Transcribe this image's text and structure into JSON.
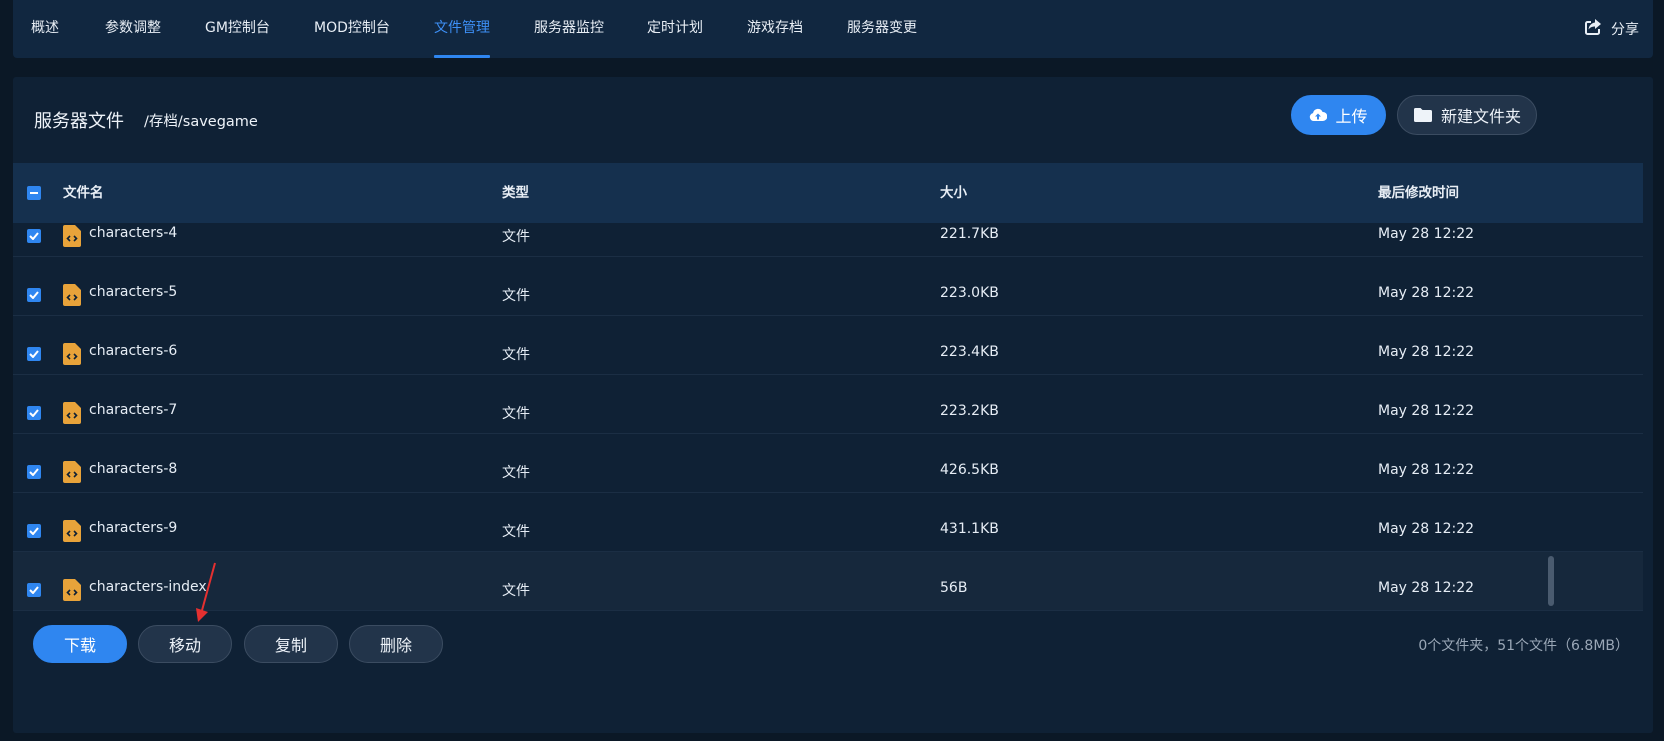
{
  "nav": {
    "tabs": [
      {
        "label": "概述"
      },
      {
        "label": "参数调整"
      },
      {
        "label": "GM控制台"
      },
      {
        "label": "MOD控制台"
      },
      {
        "label": "文件管理",
        "active": true
      },
      {
        "label": "服务器监控"
      },
      {
        "label": "定时计划"
      },
      {
        "label": "游戏存档"
      },
      {
        "label": "服务器变更"
      }
    ],
    "share_label": "分享"
  },
  "files": {
    "title": "服务器文件",
    "path": "/存档/savegame",
    "upload_label": "上传",
    "new_folder_label": "新建文件夹",
    "columns": {
      "name": "文件名",
      "type": "类型",
      "size": "大小",
      "modified": "最后修改时间"
    },
    "rows": [
      {
        "name": "characters-4",
        "type": "文件",
        "size": "221.7KB",
        "modified": "May 28 12:22",
        "checked": true
      },
      {
        "name": "characters-5",
        "type": "文件",
        "size": "223.0KB",
        "modified": "May 28 12:22",
        "checked": true
      },
      {
        "name": "characters-6",
        "type": "文件",
        "size": "223.4KB",
        "modified": "May 28 12:22",
        "checked": true
      },
      {
        "name": "characters-7",
        "type": "文件",
        "size": "223.2KB",
        "modified": "May 28 12:22",
        "checked": true
      },
      {
        "name": "characters-8",
        "type": "文件",
        "size": "426.5KB",
        "modified": "May 28 12:22",
        "checked": true
      },
      {
        "name": "characters-9",
        "type": "文件",
        "size": "431.1KB",
        "modified": "May 28 12:22",
        "checked": true
      },
      {
        "name": "characters-index",
        "type": "文件",
        "size": "56B",
        "modified": "May 28 12:22",
        "checked": true
      }
    ],
    "actions": {
      "download": "下载",
      "move": "移动",
      "copy": "复制",
      "delete": "删除"
    },
    "summary": "0个文件夹，51个文件（6.8MB）"
  },
  "colors": {
    "accent": "#2f86f0",
    "file_icon": "#e8a33a",
    "background": "#0b1826",
    "panel": "#0f2135"
  }
}
